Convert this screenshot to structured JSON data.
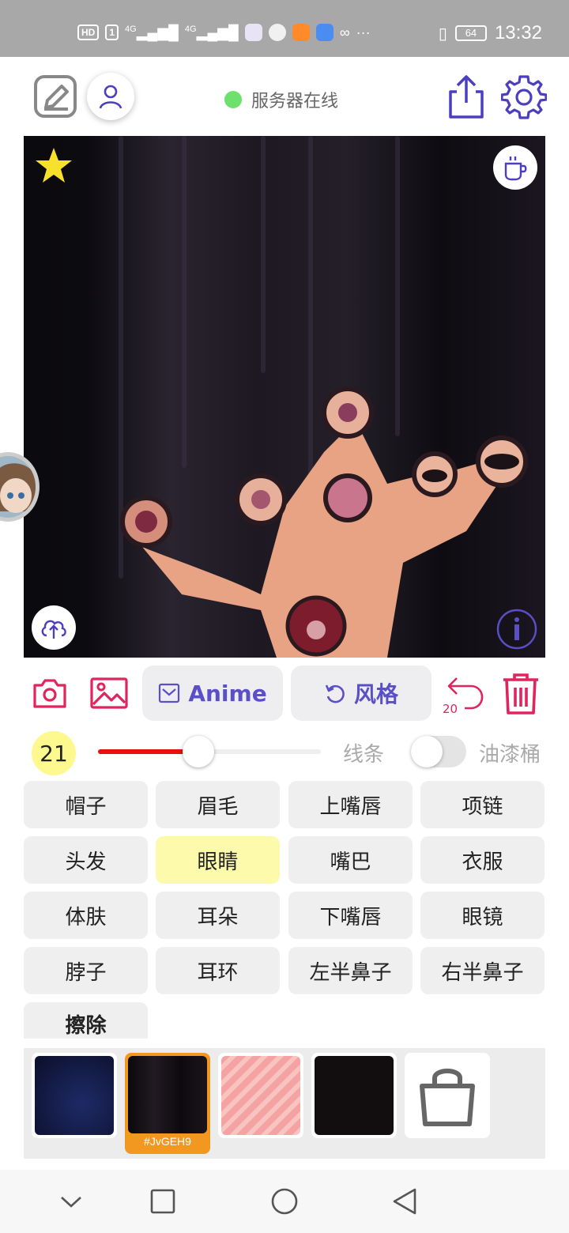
{
  "status": {
    "time": "13:32",
    "battery": "64",
    "net1": "4G",
    "net2": "4G",
    "hd": "HD",
    "sim": "1",
    "more": "···"
  },
  "header": {
    "server_status": "服务器在线",
    "status_color": "#6ee06e"
  },
  "toolbar": {
    "anime_label": "Anime",
    "style_label": "风格",
    "undo_count": "20"
  },
  "brush": {
    "size": "21",
    "line_label": "线条",
    "bucket_label": "油漆桶",
    "slider_value_percent": 45,
    "bucket_on": false
  },
  "parts": [
    {
      "label": "帽子"
    },
    {
      "label": "眉毛"
    },
    {
      "label": "上嘴唇"
    },
    {
      "label": "项链"
    },
    {
      "label": "头发"
    },
    {
      "label": "眼睛"
    },
    {
      "label": "嘴巴"
    },
    {
      "label": "衣服"
    },
    {
      "label": "体肤"
    },
    {
      "label": "耳朵"
    },
    {
      "label": "下嘴唇"
    },
    {
      "label": "眼镜"
    },
    {
      "label": "脖子"
    },
    {
      "label": "耳环"
    },
    {
      "label": "左半鼻子"
    },
    {
      "label": "右半鼻子"
    },
    {
      "label": "擦除"
    }
  ],
  "selected_part": "眼睛",
  "thumbnails": {
    "active_caption": "#JvGEH9"
  },
  "colors": {
    "accent": "#5b4fc7",
    "danger": "#e0245e",
    "selected": "#fdfbab",
    "active_thumb": "#f29720"
  }
}
